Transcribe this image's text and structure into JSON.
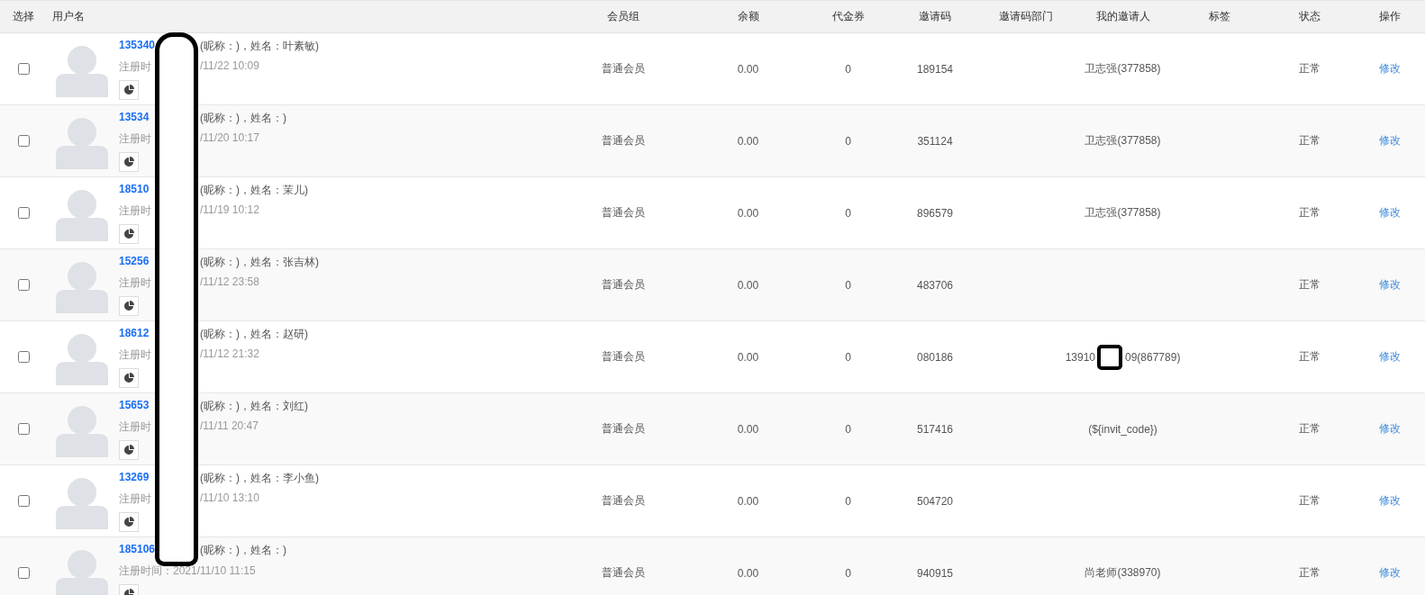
{
  "table": {
    "columns": [
      "选择",
      "用户名",
      "会员组",
      "余额",
      "代金券",
      "邀请码",
      "邀请码部门",
      "我的邀请人",
      "标签",
      "状态",
      "操作"
    ],
    "rows": [
      {
        "checked": false,
        "user_line": [
          "135340",
          "(昵称：)，姓名：叶素敏)"
        ],
        "reg_line": [
          "注册时",
          "/11/22 10:09"
        ],
        "group": "普通会员",
        "balance": "0.00",
        "voucher": "0",
        "code": "189154",
        "inviter": [
          "卫志强(377858)"
        ],
        "status": "正常",
        "action": "修改"
      },
      {
        "checked": false,
        "user_line": [
          "13534",
          "(昵称：)，姓名：)"
        ],
        "reg_line": [
          "注册时",
          "/11/20 10:17"
        ],
        "group": "普通会员",
        "balance": "0.00",
        "voucher": "0",
        "code": "351124",
        "inviter": [
          "卫志强(377858)"
        ],
        "status": "正常",
        "action": "修改"
      },
      {
        "checked": false,
        "user_line": [
          "18510",
          "(昵称：)，姓名：茉儿)"
        ],
        "reg_line": [
          "注册时",
          "/11/19 10:12"
        ],
        "group": "普通会员",
        "balance": "0.00",
        "voucher": "0",
        "code": "896579",
        "inviter": [
          "卫志强(377858)"
        ],
        "status": "正常",
        "action": "修改"
      },
      {
        "checked": false,
        "user_line": [
          "15256",
          "(昵称：)，姓名：张吉林)"
        ],
        "reg_line": [
          "注册时",
          "/11/12 23:58"
        ],
        "group": "普通会员",
        "balance": "0.00",
        "voucher": "0",
        "code": "483706",
        "status": "正常",
        "action": "修改"
      },
      {
        "checked": false,
        "user_line": [
          "18612",
          "(昵称：)，姓名：赵研)"
        ],
        "reg_line": [
          "注册时",
          "/11/12 21:32"
        ],
        "group": "普通会员",
        "balance": "0.00",
        "voucher": "0",
        "code": "080186",
        "inviter": [
          "13910",
          "09(867789)"
        ],
        "status": "正常",
        "action": "修改"
      },
      {
        "checked": false,
        "user_line": [
          "15653",
          "(昵称：)，姓名：刘红)"
        ],
        "reg_line": [
          "注册时",
          "/11/11 20:47"
        ],
        "group": "普通会员",
        "balance": "0.00",
        "voucher": "0",
        "code": "517416",
        "inviter": [
          "(${invit_code})"
        ],
        "status": "正常",
        "action": "修改"
      },
      {
        "checked": false,
        "user_line": [
          "13269",
          "(昵称：)，姓名：李小鱼)"
        ],
        "reg_line": [
          "注册时",
          "/11/10 13:10"
        ],
        "group": "普通会员",
        "balance": "0.00",
        "voucher": "0",
        "code": "504720",
        "status": "正常",
        "action": "修改"
      },
      {
        "checked": false,
        "user_line": [
          "185106",
          "(昵称：)，姓名：)"
        ],
        "reg_line": [
          "注册时间：2021/11/10 11:15"
        ],
        "group": "普通会员",
        "balance": "0.00",
        "voucher": "0",
        "code": "940915",
        "inviter": [
          "尚老师(338970)"
        ],
        "status": "正常",
        "action": "修改"
      }
    ]
  }
}
